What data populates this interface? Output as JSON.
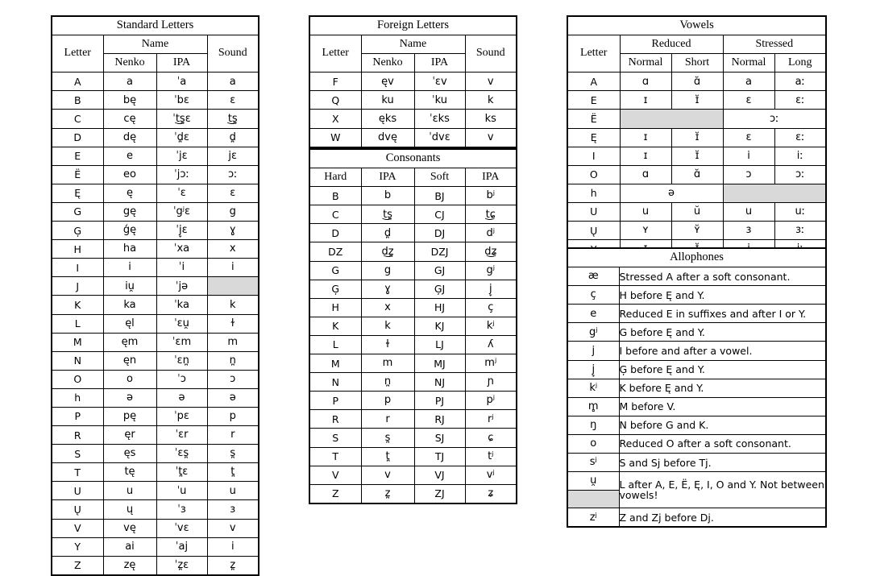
{
  "standard_letters": {
    "title": "Standard Letters",
    "headers": {
      "letter": "Letter",
      "name": "Name",
      "sound": "Sound",
      "nenko": "Nenko",
      "ipa_name": "IPA",
      "ipa_sound": "IPA"
    },
    "rows": [
      {
        "letter": "A",
        "nenko": "a",
        "ipa_name": "ˈa",
        "sound": "a"
      },
      {
        "letter": "B",
        "nenko": "bę",
        "ipa_name": "ˈbɛ",
        "sound": "ɛ"
      },
      {
        "letter": "C",
        "nenko": "cę",
        "ipa_name": "ˈt͜s̪ɛ",
        "sound": "t͜s̪"
      },
      {
        "letter": "D",
        "nenko": "dę",
        "ipa_name": "ˈd̪ɛ",
        "sound": "d̪"
      },
      {
        "letter": "E",
        "nenko": "e",
        "ipa_name": "ˈjɛ",
        "sound": "jɛ"
      },
      {
        "letter": "Ë",
        "nenko": "eo",
        "ipa_name": "ˈjɔː",
        "sound": "ɔː"
      },
      {
        "letter": "Ę",
        "nenko": "ę",
        "ipa_name": "ˈɛ",
        "sound": "ɛ"
      },
      {
        "letter": "G",
        "nenko": "gę",
        "ipa_name": "ˈgʲɛ",
        "sound": "g"
      },
      {
        "letter": "Ģ",
        "nenko": "ǵę",
        "ipa_name": "ˈj̞ɛ",
        "sound": "ɣ"
      },
      {
        "letter": "H",
        "nenko": "ha",
        "ipa_name": "ˈxa",
        "sound": "x"
      },
      {
        "letter": "I",
        "nenko": "i",
        "ipa_name": "ˈi",
        "sound": "i"
      },
      {
        "letter": "J",
        "nenko": "iu̯",
        "ipa_name": "ˈjə",
        "sound": ""
      },
      {
        "letter": "K",
        "nenko": "ka",
        "ipa_name": "ˈka",
        "sound": "k"
      },
      {
        "letter": "L",
        "nenko": "ęl",
        "ipa_name": "ˈɛu̯",
        "sound": "ɫ"
      },
      {
        "letter": "M",
        "nenko": "ęm",
        "ipa_name": "ˈɛm",
        "sound": "m"
      },
      {
        "letter": "N",
        "nenko": "ęn",
        "ipa_name": "ˈɛn̪",
        "sound": "n̪"
      },
      {
        "letter": "O",
        "nenko": "o",
        "ipa_name": "ˈɔ",
        "sound": "ɔ"
      },
      {
        "letter": "һ",
        "nenko": "ә",
        "ipa_name": "ə",
        "sound": "ə"
      },
      {
        "letter": "P",
        "nenko": "pę",
        "ipa_name": "ˈpɛ",
        "sound": "p"
      },
      {
        "letter": "R",
        "nenko": "ęr",
        "ipa_name": "ˈɛr",
        "sound": "r"
      },
      {
        "letter": "S",
        "nenko": "ęs",
        "ipa_name": "ˈɛs̪",
        "sound": "s̪"
      },
      {
        "letter": "T",
        "nenko": "tę",
        "ipa_name": "ˈt̪ɛ",
        "sound": "t̪"
      },
      {
        "letter": "U",
        "nenko": "u",
        "ipa_name": "ˈu",
        "sound": "u"
      },
      {
        "letter": "Ų",
        "nenko": "ų",
        "ipa_name": "ˈɜ",
        "sound": "ɜ"
      },
      {
        "letter": "V",
        "nenko": "vę",
        "ipa_name": "ˈvɛ",
        "sound": "v"
      },
      {
        "letter": "Y",
        "nenko": "ai",
        "ipa_name": "ˈaj",
        "sound": "i"
      },
      {
        "letter": "Z",
        "nenko": "zę",
        "ipa_name": "ˈz̪ɛ",
        "sound": "z̪"
      }
    ],
    "shaded_sound_letter": "J"
  },
  "foreign_letters": {
    "title": "Foreign Letters",
    "headers": {
      "letter": "Letter",
      "name": "Name",
      "sound": "Sound",
      "nenko": "Nenko",
      "ipa_name": "IPA",
      "ipa_sound": "IPA"
    },
    "rows": [
      {
        "letter": "F",
        "nenko": "ęv",
        "ipa_name": "ˈɛv",
        "sound": "v"
      },
      {
        "letter": "Q",
        "nenko": "ku",
        "ipa_name": "ˈku",
        "sound": "k"
      },
      {
        "letter": "X",
        "nenko": "ęks",
        "ipa_name": "ˈɛks",
        "sound": "ks"
      },
      {
        "letter": "W",
        "nenko": "dvę",
        "ipa_name": "ˈdvɛ",
        "sound": "v"
      }
    ]
  },
  "consonants": {
    "title": "Consonants",
    "headers": {
      "hard": "Hard",
      "ipa_hard": "IPA",
      "soft": "Soft",
      "ipa_soft": "IPA"
    },
    "rows": [
      {
        "hard": "B",
        "ipa_hard": "b",
        "soft": "BJ",
        "ipa_soft": "bʲ"
      },
      {
        "hard": "C",
        "ipa_hard": "t͜s̪",
        "soft": "CJ",
        "ipa_soft": "t͜ɕ"
      },
      {
        "hard": "D",
        "ipa_hard": "d̪",
        "soft": "DJ",
        "ipa_soft": "dʲ"
      },
      {
        "hard": "DZ",
        "ipa_hard": "d͜z̪",
        "soft": "DZJ",
        "ipa_soft": "d͜ʑ"
      },
      {
        "hard": "G",
        "ipa_hard": "g",
        "soft": "GJ",
        "ipa_soft": "gʲ"
      },
      {
        "hard": "Ģ",
        "ipa_hard": "ɣ",
        "soft": "ĢJ",
        "ipa_soft": "j̞"
      },
      {
        "hard": "H",
        "ipa_hard": "x",
        "soft": "HJ",
        "ipa_soft": "ç"
      },
      {
        "hard": "K",
        "ipa_hard": "k",
        "soft": "KJ",
        "ipa_soft": "kʲ"
      },
      {
        "hard": "L",
        "ipa_hard": "ɫ",
        "soft": "LJ",
        "ipa_soft": "ʎ"
      },
      {
        "hard": "M",
        "ipa_hard": "m",
        "soft": "MJ",
        "ipa_soft": "mʲ"
      },
      {
        "hard": "N",
        "ipa_hard": "n̪",
        "soft": "NJ",
        "ipa_soft": "ɲ"
      },
      {
        "hard": "P",
        "ipa_hard": "p",
        "soft": "PJ",
        "ipa_soft": "pʲ"
      },
      {
        "hard": "R",
        "ipa_hard": "r",
        "soft": "RJ",
        "ipa_soft": "rʲ"
      },
      {
        "hard": "S",
        "ipa_hard": "s̪",
        "soft": "SJ",
        "ipa_soft": "ɕ"
      },
      {
        "hard": "T",
        "ipa_hard": "t̪",
        "soft": "TJ",
        "ipa_soft": "tʲ"
      },
      {
        "hard": "V",
        "ipa_hard": "v",
        "soft": "VJ",
        "ipa_soft": "vʲ"
      },
      {
        "hard": "Z",
        "ipa_hard": "z̪",
        "soft": "ZJ",
        "ipa_soft": "ʑ"
      }
    ]
  },
  "vowels": {
    "title": "Vowels",
    "headers": {
      "letter": "Letter",
      "reduced": "Reduced",
      "stressed": "Stressed",
      "reduced_normal": "Normal",
      "reduced_short": "Short",
      "stressed_normal": "Normal",
      "stressed_long": "Long"
    },
    "rows": [
      {
        "letter": "A",
        "reduced_normal": "ɑ",
        "reduced_short": "ɑ̆",
        "stressed_normal": "a",
        "stressed_long": "aː"
      },
      {
        "letter": "E",
        "reduced_normal": "ɪ",
        "reduced_short": "ɪ̆",
        "stressed_normal": "ɛ",
        "stressed_long": "ɛː"
      },
      {
        "letter": "Ë",
        "reduced_merged": "",
        "reduced_shaded": true,
        "stressed_merged": "ɔː"
      },
      {
        "letter": "Ę",
        "reduced_normal": "ɪ",
        "reduced_short": "ɪ̆",
        "stressed_normal": "ɛ",
        "stressed_long": "ɛː"
      },
      {
        "letter": "I",
        "reduced_normal": "ɪ",
        "reduced_short": "ɪ̆",
        "stressed_normal": "i",
        "stressed_long": "iː"
      },
      {
        "letter": "O",
        "reduced_normal": "ɑ",
        "reduced_short": "ɑ̆",
        "stressed_normal": "ɔ",
        "stressed_long": "ɔː"
      },
      {
        "letter": "һ",
        "reduced_merged": "ə",
        "stressed_merged": "",
        "stressed_shaded": true
      },
      {
        "letter": "U",
        "reduced_normal": "u",
        "reduced_short": "ŭ",
        "stressed_normal": "u",
        "stressed_long": "uː"
      },
      {
        "letter": "Ų",
        "reduced_normal": "ʏ",
        "reduced_short": "ʏ̆",
        "stressed_normal": "ɜ",
        "stressed_long": "ɜː"
      },
      {
        "letter": "Y",
        "reduced_normal": "ɪ",
        "reduced_short": "ɪ̆",
        "stressed_normal": "i",
        "stressed_long": "iː"
      }
    ]
  },
  "allophones": {
    "title": "Allophones",
    "rows": [
      {
        "symbol": "æ",
        "description": "Stressed A after a soft consonant."
      },
      {
        "symbol": "ç",
        "description": "H before Ę and Y."
      },
      {
        "symbol": "e",
        "description": "Reduced E in suffixes and after I or Y."
      },
      {
        "symbol": "gʲ",
        "description": "G before Ę and Y."
      },
      {
        "symbol": "j",
        "description": "I before and after a vowel."
      },
      {
        "symbol": "j̞",
        "description": "Ģ before Ę and Y."
      },
      {
        "symbol": "kʲ",
        "description": "K before Ę and Y."
      },
      {
        "symbol": "m̻",
        "description": "M before V."
      },
      {
        "symbol": "ŋ",
        "description": "N before G and K."
      },
      {
        "symbol": "o",
        "description": "Reduced O after a soft consonant."
      },
      {
        "symbol": "sʲ",
        "description": "S and Sj before Tj."
      },
      {
        "symbol": "u̯",
        "description": "L after A, E, Ë, Ę, I, O and Y. Not between vowels!",
        "two_lines": true
      },
      {
        "symbol": "zʲ",
        "description": "Z and Zj before Dj."
      }
    ]
  }
}
